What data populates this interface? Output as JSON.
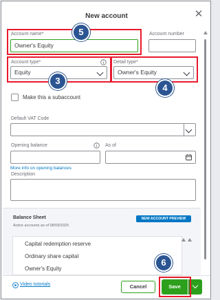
{
  "dialog": {
    "title": "New account",
    "close_glyph": "✕"
  },
  "fields": {
    "account_name_label": "Account name*",
    "account_name_value": "Owner's Equity",
    "account_number_label": "Account number",
    "account_type_label": "Account type*",
    "account_type_value": "Equity",
    "detail_type_label": "Detail type*",
    "detail_type_value": "Owner's Equity",
    "subaccount_label": "Make this a subaccount",
    "vat_code_label": "Default VAT Code",
    "opening_balance_label": "Opening balance",
    "as_of_label": "As of",
    "opening_balance_link": "More info on opening balances",
    "description_label": "Description"
  },
  "badges": {
    "step_5": "5",
    "step_3": "3",
    "step_4": "4",
    "step_6": "6"
  },
  "balance_sheet": {
    "title": "Balance Sheet",
    "subtitle": "Active accounts as of 08/09/2025",
    "preview_button": "NEW ACCOUNT PREVIEW",
    "items": [
      "Capital redemption reserve",
      "Ordinary share capital",
      "Owner's Equity"
    ]
  },
  "footer": {
    "video_link": "Video tutorials",
    "cancel": "Cancel",
    "save": "Save"
  },
  "colors": {
    "accent_green": "#2ca01c",
    "highlight_red": "#e8192c",
    "badge_blue": "#2b5592",
    "link_blue": "#0077c5"
  },
  "icons": [
    "close-icon",
    "info-icon",
    "chevron-down-icon",
    "calendar-icon",
    "play-circle-icon"
  ]
}
